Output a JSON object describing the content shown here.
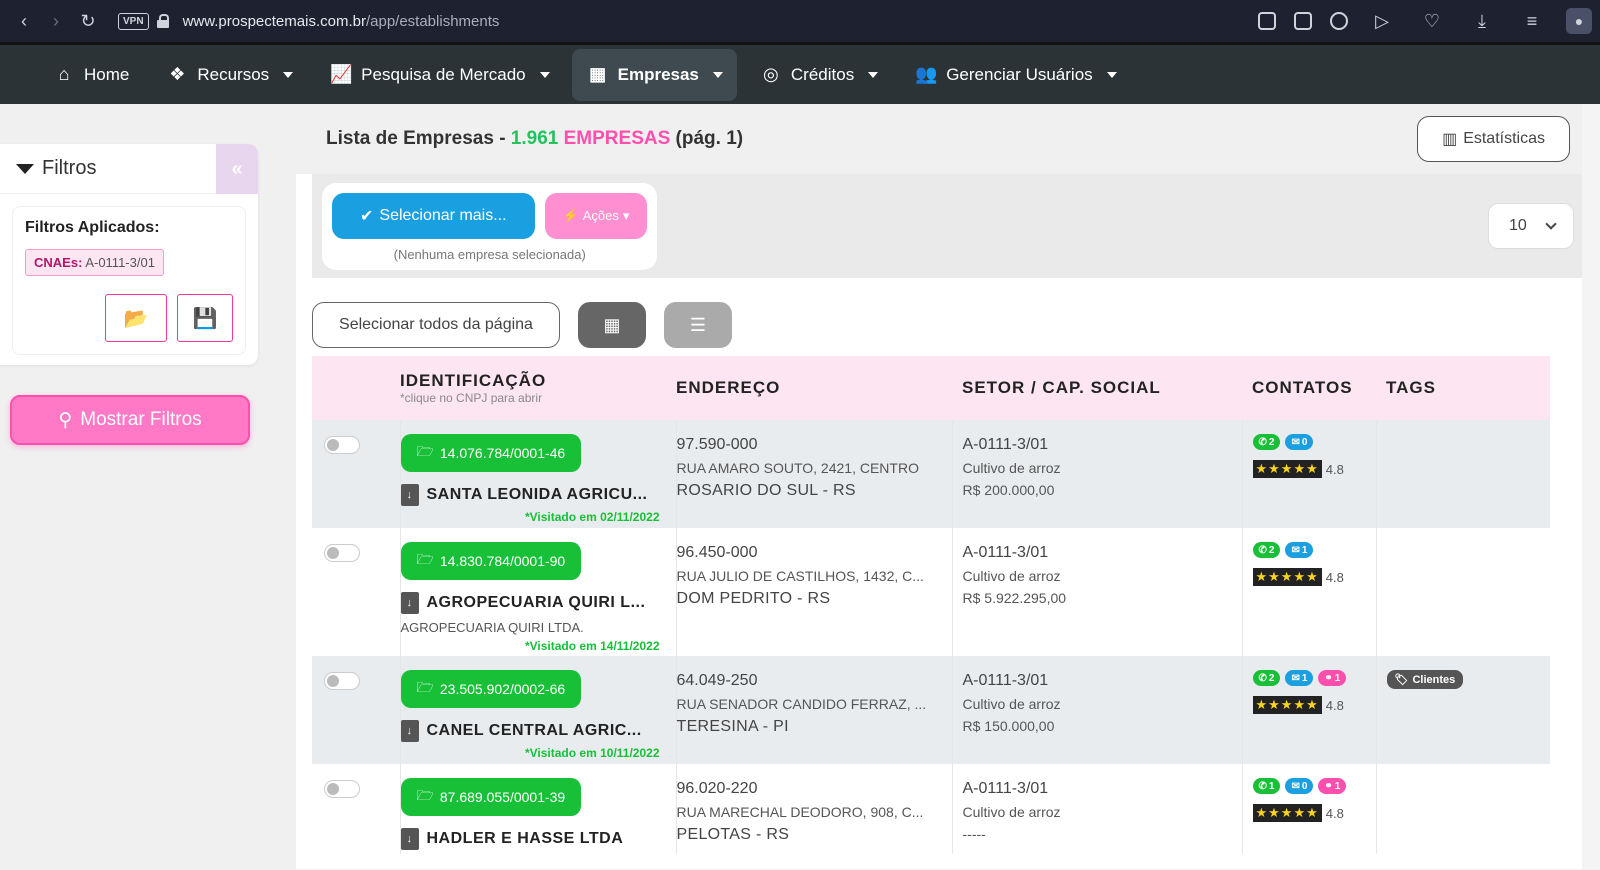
{
  "browser": {
    "url_host": "www.prospectemais.com.br",
    "url_path": "/app/establishments",
    "vpn_label": "VPN"
  },
  "nav": {
    "items": [
      {
        "label": "Home",
        "icon": "home-icon",
        "glyph": "⌂"
      },
      {
        "label": "Recursos",
        "icon": "cubes-icon",
        "glyph": "❖"
      },
      {
        "label": "Pesquisa de Mercado",
        "icon": "chart-line-icon",
        "glyph": "📈"
      },
      {
        "label": "Empresas",
        "icon": "building-icon",
        "glyph": "▦"
      },
      {
        "label": "Créditos",
        "icon": "coins-icon",
        "glyph": "◎"
      },
      {
        "label": "Gerenciar Usuários",
        "icon": "users-icon",
        "glyph": "👥"
      }
    ],
    "active": "Empresas"
  },
  "sidebar": {
    "title": "Filtros",
    "collapse_glyph": "«",
    "applied_title": "Filtros Aplicados:",
    "cnae_label": "CNAEs:",
    "cnae_value": "A-0111-3/01",
    "show_filters": "Mostrar Filtros"
  },
  "header": {
    "prefix": "Lista de Empresas - ",
    "count": "1.961",
    "word": "EMPRESAS",
    "page": "(pág. 1)",
    "stats_button": "Estatísticas"
  },
  "actions": {
    "select_more": "Selecionar mais...",
    "actions_label": "Ações",
    "none_selected": "(Nenhuma empresa selecionada)",
    "per_page": "10",
    "select_all_page": "Selecionar todos da página"
  },
  "table": {
    "headers": {
      "id": "IDENTIFICAÇÃO",
      "id_sub": "*clique no CNPJ para abrir",
      "address": "ENDEREÇO",
      "sector": "SETOR / CAP. SOCIAL",
      "contacts": "CONTATOS",
      "tags": "TAGS"
    },
    "rows": [
      {
        "cnpj": "14.076.784/0001-46",
        "name": "SANTA LEONIDA AGRICU...",
        "fantasy": "",
        "visited": "*Visitado em 02/11/2022",
        "cep": "97.590-000",
        "street": "RUA AMARO SOUTO, 2421, CENTRO",
        "city": "ROSARIO DO SUL - RS",
        "cnae": "A-0111-3/01",
        "activity": "Cultivo de arroz",
        "capital": "R$ 200.000,00",
        "phones": "2",
        "emails": "0",
        "links": "",
        "rating": "4.8",
        "tag": ""
      },
      {
        "cnpj": "14.830.784/0001-90",
        "name": "AGROPECUARIA QUIRI L...",
        "fantasy": "AGROPECUARIA QUIRI LTDA.",
        "visited": "*Visitado em 14/11/2022",
        "cep": "96.450-000",
        "street": "RUA JULIO DE CASTILHOS, 1432, C...",
        "city": "DOM PEDRITO - RS",
        "cnae": "A-0111-3/01",
        "activity": "Cultivo de arroz",
        "capital": "R$ 5.922.295,00",
        "phones": "2",
        "emails": "1",
        "links": "",
        "rating": "4.8",
        "tag": ""
      },
      {
        "cnpj": "23.505.902/0002-66",
        "name": "CANEL CENTRAL AGRIC...",
        "fantasy": "",
        "visited": "*Visitado em 10/11/2022",
        "cep": "64.049-250",
        "street": "RUA SENADOR CANDIDO FERRAZ, ...",
        "city": "TERESINA - PI",
        "cnae": "A-0111-3/01",
        "activity": "Cultivo de arroz",
        "capital": "R$ 150.000,00",
        "phones": "2",
        "emails": "1",
        "links": "1",
        "rating": "4.8",
        "tag": "Clientes"
      },
      {
        "cnpj": "87.689.055/0001-39",
        "name": "HADLER E HASSE LTDA",
        "fantasy": "",
        "visited": "",
        "cep": "96.020-220",
        "street": "RUA MARECHAL DEODORO, 908, C...",
        "city": "PELOTAS - RS",
        "cnae": "A-0111-3/01",
        "activity": "Cultivo de arroz",
        "capital": "-----",
        "phones": "1",
        "emails": "0",
        "links": "1",
        "rating": "4.8",
        "tag": ""
      }
    ]
  },
  "colors": {
    "accent_green": "#17c037",
    "accent_pink": "#ff4fae",
    "accent_blue": "#1a9fe0",
    "nav_bg": "#2b3336"
  }
}
